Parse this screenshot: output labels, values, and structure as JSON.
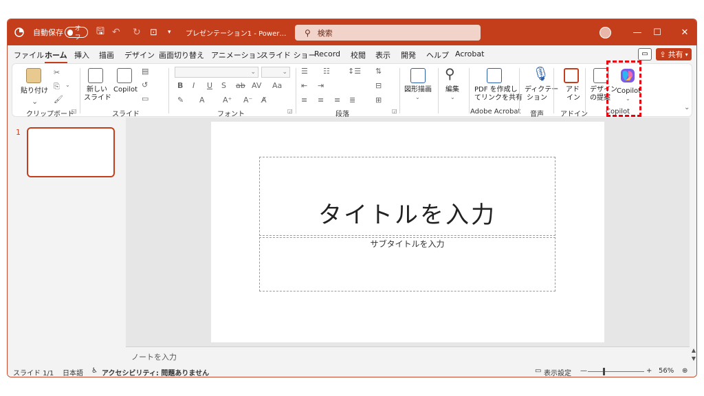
{
  "titlebar": {
    "autosave_label": "自動保存",
    "autosave_state": "オフ",
    "doc_title": "プレゼンテーション1  -  Power…",
    "search_placeholder": "検索"
  },
  "tabs": [
    "ファイル",
    "ホーム",
    "挿入",
    "描画",
    "デザイン",
    "画面切り替え",
    "アニメーション",
    "スライド ショー",
    "Record",
    "校閲",
    "表示",
    "開発",
    "ヘルプ",
    "Acrobat"
  ],
  "share_label": "共有",
  "ribbon": {
    "paste_label": "貼り付け",
    "new_slide_label_1": "新しい",
    "new_slide_label_2": "スライド",
    "copilot_small_label": "Copilot",
    "shapes_label": "図形描画",
    "edit_label": "編集",
    "pdf_label_1": "PDF を作成し",
    "pdf_label_2": "てリンクを共有",
    "dictate_label_1": "ディクテー",
    "dictate_label_2": "ション",
    "addin_label_1": "アド",
    "addin_label_2": "イン",
    "designer_label_1": "デザイン",
    "designer_label_2": "の提案",
    "copilot_label": "Copilot",
    "groups": {
      "clipboard": "クリップボード",
      "slides": "スライド",
      "font": "フォント",
      "paragraph": "段落",
      "acrobat": "Adobe Acrobat",
      "voice": "音声",
      "addin": "アドイン",
      "copilot": "Copilot"
    }
  },
  "slide_panel": {
    "slide_number": "1"
  },
  "slide": {
    "title_placeholder": "タイトルを入力",
    "subtitle_placeholder": "サブタイトルを入力"
  },
  "notes_placeholder": "ノートを入力",
  "status": {
    "slide_count": "スライド 1/1",
    "language": "日本語",
    "accessibility": "アクセシビリティ: 問題ありません",
    "display_settings": "表示設定",
    "zoom": "56%",
    "zoom_level": 0.56
  },
  "colors": {
    "accent": "#c43e1c",
    "highlight": "#e8000c"
  }
}
